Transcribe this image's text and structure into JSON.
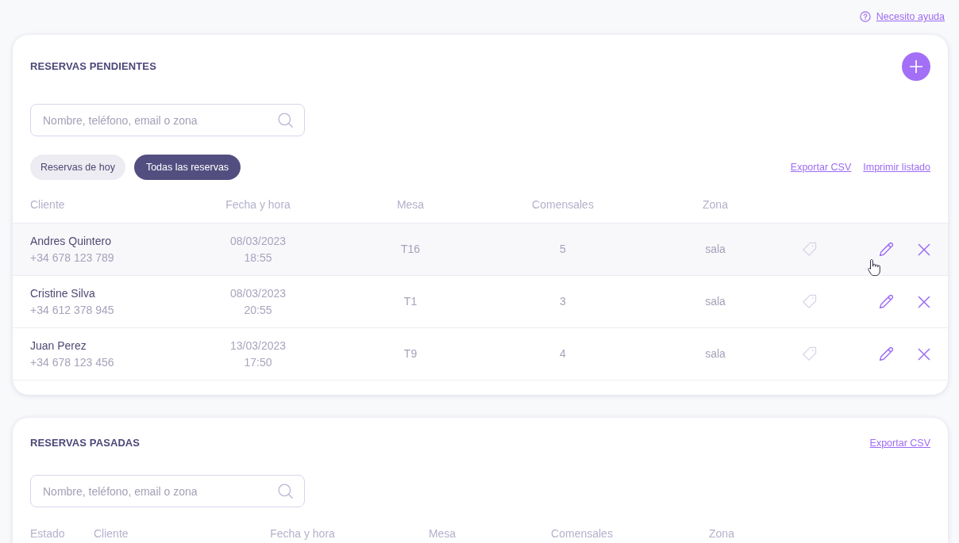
{
  "help_link": {
    "label": "Necesito ayuda"
  },
  "pending": {
    "title": "RESERVAS PENDIENTES",
    "search": {
      "placeholder": "Nombre, teléfono, email o zona"
    },
    "filters": [
      {
        "label": "Reservas de hoy",
        "selected": false
      },
      {
        "label": "Todas las reservas",
        "selected": true
      }
    ],
    "links": [
      {
        "label": "Exportar CSV"
      },
      {
        "label": "Imprimir listado"
      }
    ],
    "table": {
      "columns": [
        "Cliente",
        "Fecha y hora",
        "Mesa",
        "Comensales",
        "Zona"
      ],
      "rows": [
        {
          "name": "Andres Quintero",
          "phone": "+34 678 123 789",
          "date": "08/03/2023",
          "time": "18:55",
          "table": "T16",
          "guests": "5",
          "zone": "sala",
          "hovered": true
        },
        {
          "name": "Cristine Silva",
          "phone": "+34 612 378 945",
          "date": "08/03/2023",
          "time": "20:55",
          "table": "T1",
          "guests": "3",
          "zone": "sala",
          "hovered": false
        },
        {
          "name": "Juan Perez",
          "phone": "+34 678 123 456",
          "date": "13/03/2023",
          "time": "17:50",
          "table": "T9",
          "guests": "4",
          "zone": "sala",
          "hovered": false
        }
      ]
    }
  },
  "past": {
    "title": "RESERVAS PASADAS",
    "links": [
      {
        "label": "Exportar CSV"
      }
    ],
    "search": {
      "placeholder": "Nombre, teléfono, email o zona"
    },
    "table": {
      "columns": [
        "Estado",
        "Cliente",
        "Fecha y hora",
        "Mesa",
        "Comensales",
        "Zona"
      ]
    }
  }
}
